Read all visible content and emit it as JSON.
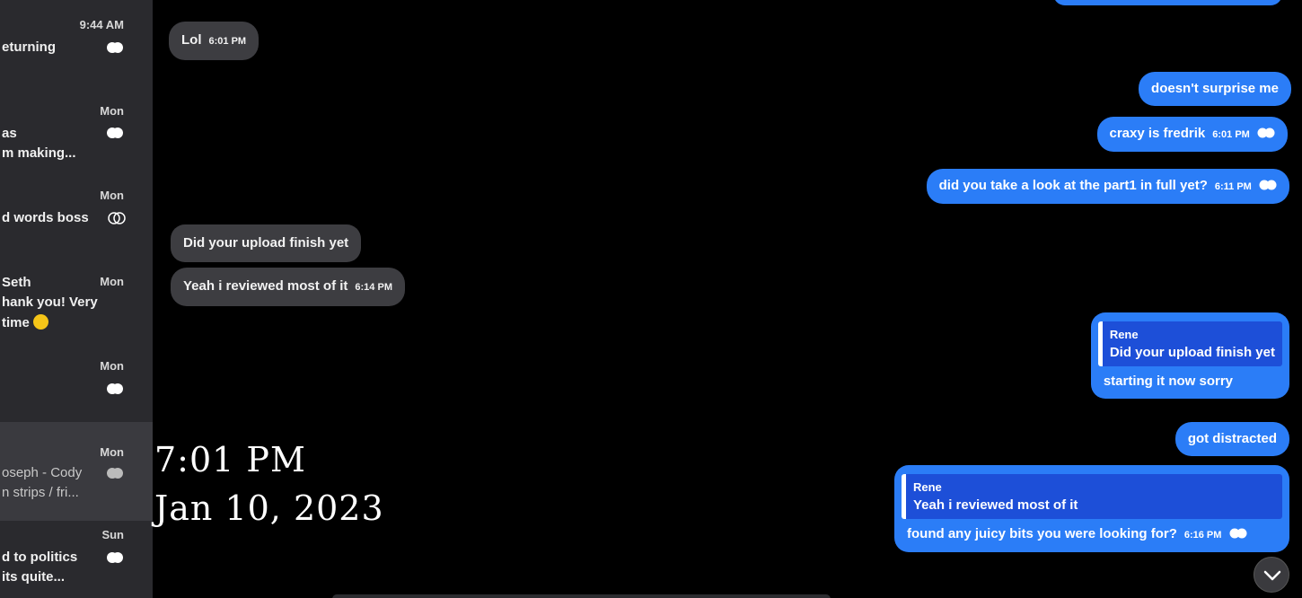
{
  "sidebar": {
    "conversations": [
      {
        "time": "9:44 AM",
        "line1": "eturning",
        "line2": "",
        "line3": ""
      },
      {
        "time": "Mon",
        "line1": "as",
        "line2": "m making...",
        "line3": ""
      },
      {
        "time": "Mon",
        "line1": "d words boss",
        "line2": "",
        "line3": ""
      },
      {
        "time": "Mon",
        "line1": "Seth",
        "line2": "hank you! Very",
        "line3": "time"
      },
      {
        "time": "Mon",
        "line1": "",
        "line2": "",
        "line3": ""
      },
      {
        "time": "Mon",
        "line1": "oseph - Cody",
        "line2": "n strips / fri...",
        "line3": ""
      },
      {
        "time": "Sun",
        "line1": "d to politics",
        "line2": "its quite...",
        "line3": ""
      }
    ]
  },
  "messages": {
    "in1": {
      "text": "Lol",
      "time": "6:01 PM"
    },
    "in2": {
      "text": "Did your upload finish yet"
    },
    "in3": {
      "text": "Yeah i reviewed most of it",
      "time": "6:14 PM"
    },
    "out1": {
      "text": "doesn't surprise me"
    },
    "out2": {
      "text": "craxy is fredrik",
      "time": "6:01 PM"
    },
    "out3": {
      "text": "did you take a look at the part1 in full yet?",
      "time": "6:11 PM"
    },
    "out4": {
      "quote_name": "Rene",
      "quote_text": "Did your upload finish yet",
      "text": "starting it now sorry"
    },
    "out5": {
      "text": "got distracted"
    },
    "out6": {
      "quote_name": "Rene",
      "quote_text": "Yeah i reviewed most of it",
      "text": "found any juicy bits you were looking for?",
      "time": "6:16 PM"
    }
  },
  "overlay": {
    "time": "7:01 PM",
    "date": "Jan 10, 2023"
  },
  "colors": {
    "outgoing": "#2b7df7",
    "incoming": "#3d3d41",
    "sidebar": "#2a2a2e"
  },
  "icons": {
    "read_receipt": "double-check-icon",
    "scroll": "chevron-down-icon"
  }
}
